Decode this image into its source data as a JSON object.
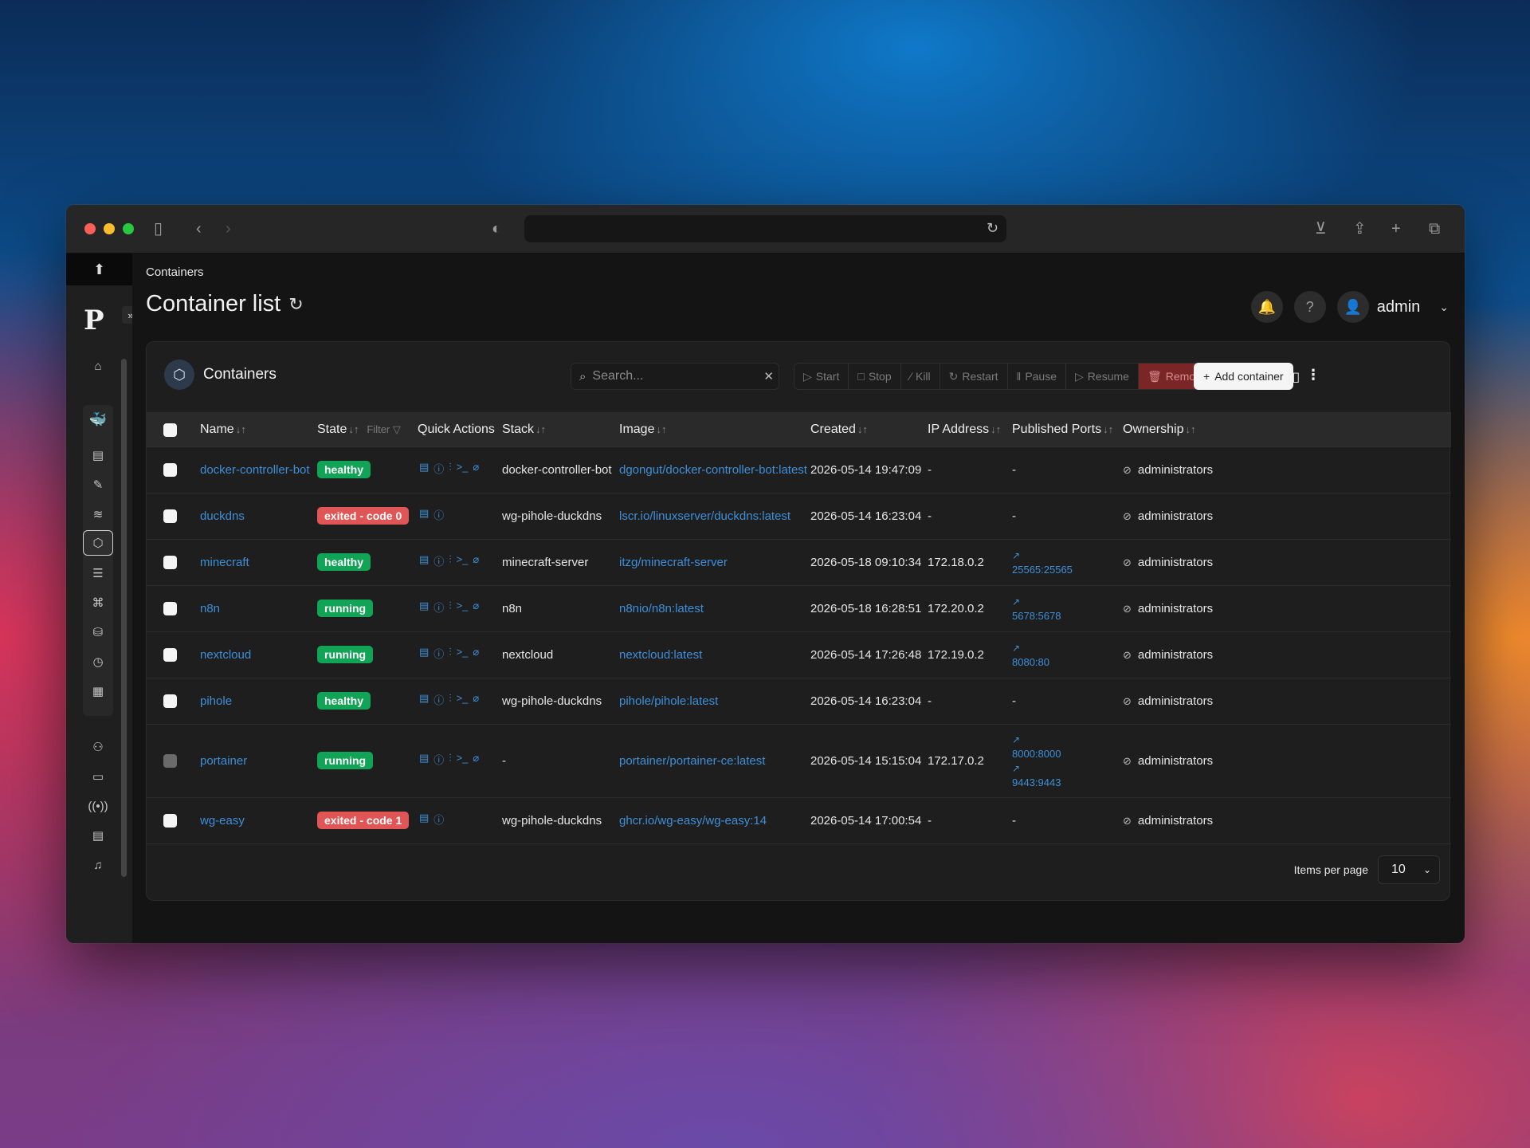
{
  "browser": {
    "url": ""
  },
  "breadcrumb": "Containers",
  "page_title": "Container list",
  "user": {
    "name": "admin"
  },
  "panel": {
    "title": "Containers"
  },
  "search": {
    "placeholder": "Search..."
  },
  "actions": {
    "start": "Start",
    "stop": "Stop",
    "kill": "Kill",
    "restart": "Restart",
    "pause": "Pause",
    "resume": "Resume",
    "remove": "Remove"
  },
  "add_container": "Add container",
  "columns": {
    "name": "Name",
    "state": "State",
    "filter": "Filter",
    "quick_actions": "Quick Actions",
    "stack": "Stack",
    "image": "Image",
    "created": "Created",
    "ip": "IP Address",
    "ports": "Published Ports",
    "ownership": "Ownership"
  },
  "rows": [
    {
      "name": "docker-controller-bot",
      "state": "healthy",
      "stack": "docker-controller-bot",
      "image": "dgongut/docker-controller-bot:latest",
      "created": "2026-05-14 19:47:09",
      "ip": "-",
      "ports": [
        "-"
      ],
      "ownership": "administrators"
    },
    {
      "name": "duckdns",
      "state": "exited - code 0",
      "stack": "wg-pihole-duckdns",
      "image": "lscr.io/linuxserver/duckdns:latest",
      "created": "2026-05-14 16:23:04",
      "ip": "-",
      "ports": [
        "-"
      ],
      "ownership": "administrators"
    },
    {
      "name": "minecraft",
      "state": "healthy",
      "stack": "minecraft-server",
      "image": "itzg/minecraft-server",
      "created": "2026-05-18 09:10:34",
      "ip": "172.18.0.2",
      "ports": [
        "25565:25565"
      ],
      "ownership": "administrators"
    },
    {
      "name": "n8n",
      "state": "running",
      "stack": "n8n",
      "image": "n8nio/n8n:latest",
      "created": "2026-05-18 16:28:51",
      "ip": "172.20.0.2",
      "ports": [
        "5678:5678"
      ],
      "ownership": "administrators"
    },
    {
      "name": "nextcloud",
      "state": "running",
      "stack": "nextcloud",
      "image": "nextcloud:latest",
      "created": "2026-05-14 17:26:48",
      "ip": "172.19.0.2",
      "ports": [
        "8080:80"
      ],
      "ownership": "administrators"
    },
    {
      "name": "pihole",
      "state": "healthy",
      "stack": "wg-pihole-duckdns",
      "image": "pihole/pihole:latest",
      "created": "2026-05-14 16:23:04",
      "ip": "-",
      "ports": [
        "-"
      ],
      "ownership": "administrators"
    },
    {
      "name": "portainer",
      "state": "running",
      "stack": "-",
      "image": "portainer/portainer-ce:latest",
      "created": "2026-05-14 15:15:04",
      "ip": "172.17.0.2",
      "ports": [
        "8000:8000",
        "9443:9443"
      ],
      "ownership": "administrators"
    },
    {
      "name": "wg-easy",
      "state": "exited - code 1",
      "stack": "wg-pihole-duckdns",
      "image": "ghcr.io/wg-easy/wg-easy:14",
      "created": "2026-05-14 17:00:54",
      "ip": "-",
      "ports": [
        "-"
      ],
      "ownership": "administrators"
    }
  ],
  "pagination": {
    "label": "Items per page",
    "value": "10"
  },
  "colors": {
    "healthy": "#12a456",
    "exited": "#e05555",
    "link": "#3e8fd8",
    "remove": "#7a2626"
  }
}
